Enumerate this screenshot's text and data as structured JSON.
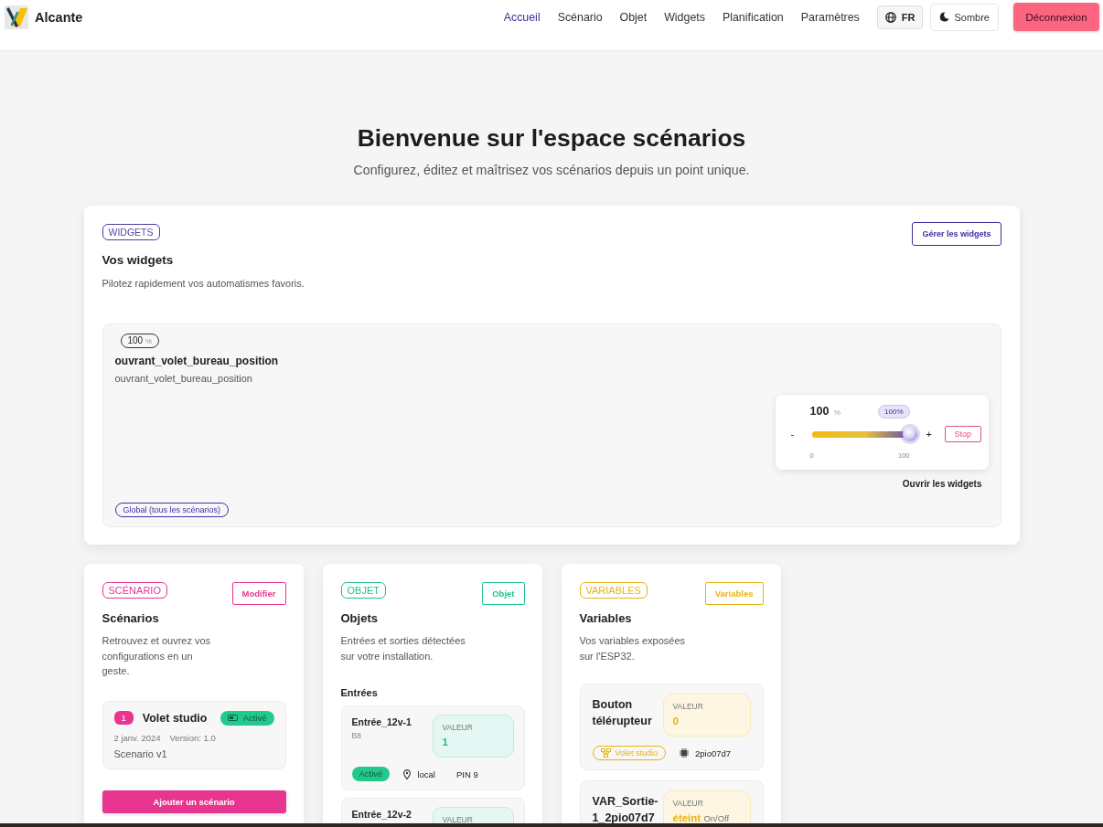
{
  "header": {
    "brand": "Alcante",
    "nav": [
      {
        "label": "Accueil",
        "selected": true
      },
      {
        "label": "Scénario",
        "selected": false
      },
      {
        "label": "Objet",
        "selected": false
      },
      {
        "label": "Widgets",
        "selected": false
      },
      {
        "label": "Planification",
        "selected": false
      },
      {
        "label": "Paramètres",
        "selected": false
      }
    ],
    "language_button": "FR",
    "theme_button": "Sombre",
    "logout_button": "Déconnexion"
  },
  "hero": {
    "title": "Bienvenue sur l'espace scénarios",
    "subtitle": "Configurez, éditez et maîtrisez vos scénarios depuis un point unique."
  },
  "widgets_section": {
    "tag": "WIDGETS",
    "title": "Vos widgets",
    "description": "Pilotez rapidement vos automatismes favoris.",
    "manage_button": "Gérer les widgets",
    "widget": {
      "badge": {
        "value": "100",
        "unit": "%"
      },
      "title": "ouvrant_volet_bureau_position",
      "subtitle": "ouvrant_volet_bureau_position",
      "control": {
        "value": "100",
        "unit": "%",
        "bubble": "100%",
        "minus": "-",
        "plus": "+",
        "level": 1,
        "stop_button": "Stop",
        "min_label": "0",
        "max_label": "100"
      },
      "open_link": "Ouvrir les widgets",
      "scope_tag": "Global (tous les scénarios)"
    }
  },
  "cards": [
    {
      "kind": "scenarios",
      "color": "#e8358f",
      "tag": "SCÉNARIO",
      "button": "Modifier",
      "title": "Scénarios",
      "description": "Retrouvez et ouvrez vos configurations en un geste.",
      "items": [
        {
          "number": "1",
          "name": "Volet studio",
          "status": "Activé",
          "active": true,
          "date": "2 janv. 2024",
          "version": "Version: 1.0",
          "note": "Scenario v1"
        }
      ],
      "add_button": "Ajouter un scénario"
    },
    {
      "kind": "objects",
      "color": "#1fbf8f",
      "tag": "OBJET",
      "button": "Objet",
      "title": "Objets",
      "description": "Entrées et sorties détectées sur votre installation.",
      "section_label": "Entrées",
      "items": [
        {
          "name": "Entrée_12v-1",
          "code": "B8",
          "value_label": "VALEUR",
          "value": "1",
          "status": "Activé",
          "active": true,
          "location": "local",
          "pin": "PIN 9"
        },
        {
          "name": "Entrée_12v-2",
          "value_label": "VALEUR"
        }
      ]
    },
    {
      "kind": "variables",
      "color": "#e9b310",
      "tag": "VARIABLES",
      "button": "Variables",
      "title": "Variables",
      "description": "Vos variables exposées sur l'ESP32.",
      "items": [
        {
          "name": "Bouton télérupteur",
          "value_label": "VALEUR",
          "value": "0",
          "scenario": "Volet studio",
          "device": "2pio07d7"
        },
        {
          "name": "VAR_Sortie-1_2pio07d7",
          "value_label": "VALEUR",
          "value": "éteint",
          "unit": "On/Off"
        }
      ]
    }
  ]
}
